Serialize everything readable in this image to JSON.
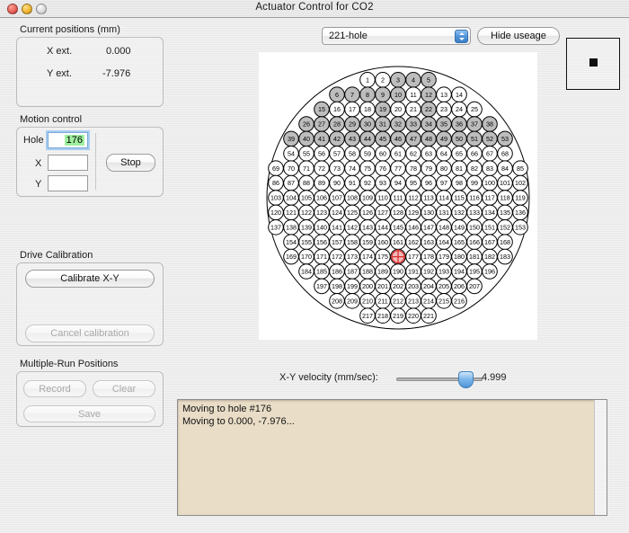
{
  "window": {
    "title": "Actuator Control for CO2",
    "traffic_lights": [
      "close",
      "minimize",
      "zoom"
    ]
  },
  "current_positions": {
    "group_label": "Current positions (mm)",
    "rows": [
      {
        "label": "X ext.",
        "value": "0.000"
      },
      {
        "label": "Y ext.",
        "value": "-7.976"
      }
    ]
  },
  "motion_control": {
    "group_label": "Motion control",
    "hole_label": "Hole",
    "hole_value": "176",
    "x_label": "X",
    "x_value": "",
    "y_label": "Y",
    "y_value": "",
    "stop_label": "Stop"
  },
  "drive_calibration": {
    "group_label": "Drive Calibration",
    "calibrate_label": "Calibrate X-Y",
    "cancel_label": "Cancel calibration",
    "cancel_disabled": true
  },
  "multiple_run": {
    "group_label": "Multiple-Run Positions",
    "record_label": "Record",
    "clear_label": "Clear",
    "save_label": "Save",
    "all_disabled": true
  },
  "toolbar": {
    "plate_selected": "221-hole",
    "plate_options": [
      "221-hole"
    ],
    "hide_useage_label": "Hide useage"
  },
  "velocity": {
    "label": "X-Y velocity (mm/sec):",
    "value": "4.999",
    "percent": 93
  },
  "log": {
    "lines": [
      "Moving to hole #176",
      "Moving to 0.000, -7.976..."
    ],
    "text": "Moving to hole #176\nMoving to 0.000, -7.976..."
  },
  "map": {
    "total_holes": 221,
    "selected_hole": 176,
    "row_counts": [
      5,
      9,
      11,
      13,
      15,
      15,
      17,
      17,
      17,
      17,
      17,
      15,
      15,
      13,
      11,
      9,
      5
    ],
    "used_holes": [
      3,
      4,
      5,
      6,
      7,
      8,
      9,
      10,
      12,
      15,
      19,
      22,
      26,
      27,
      28,
      29,
      30,
      31,
      32,
      33,
      34,
      35,
      36,
      37,
      38,
      39,
      40,
      41,
      42,
      43,
      44,
      45,
      46,
      47,
      48,
      49,
      50,
      51,
      52,
      53
    ],
    "colors": {
      "hole_fill_unused": "#ffffff",
      "hole_fill_used": "#bdbdbd",
      "hole_stroke": "#000000",
      "selected_marker": "#d83030",
      "plate_outline": "#000000",
      "background": "#ffffff"
    }
  }
}
